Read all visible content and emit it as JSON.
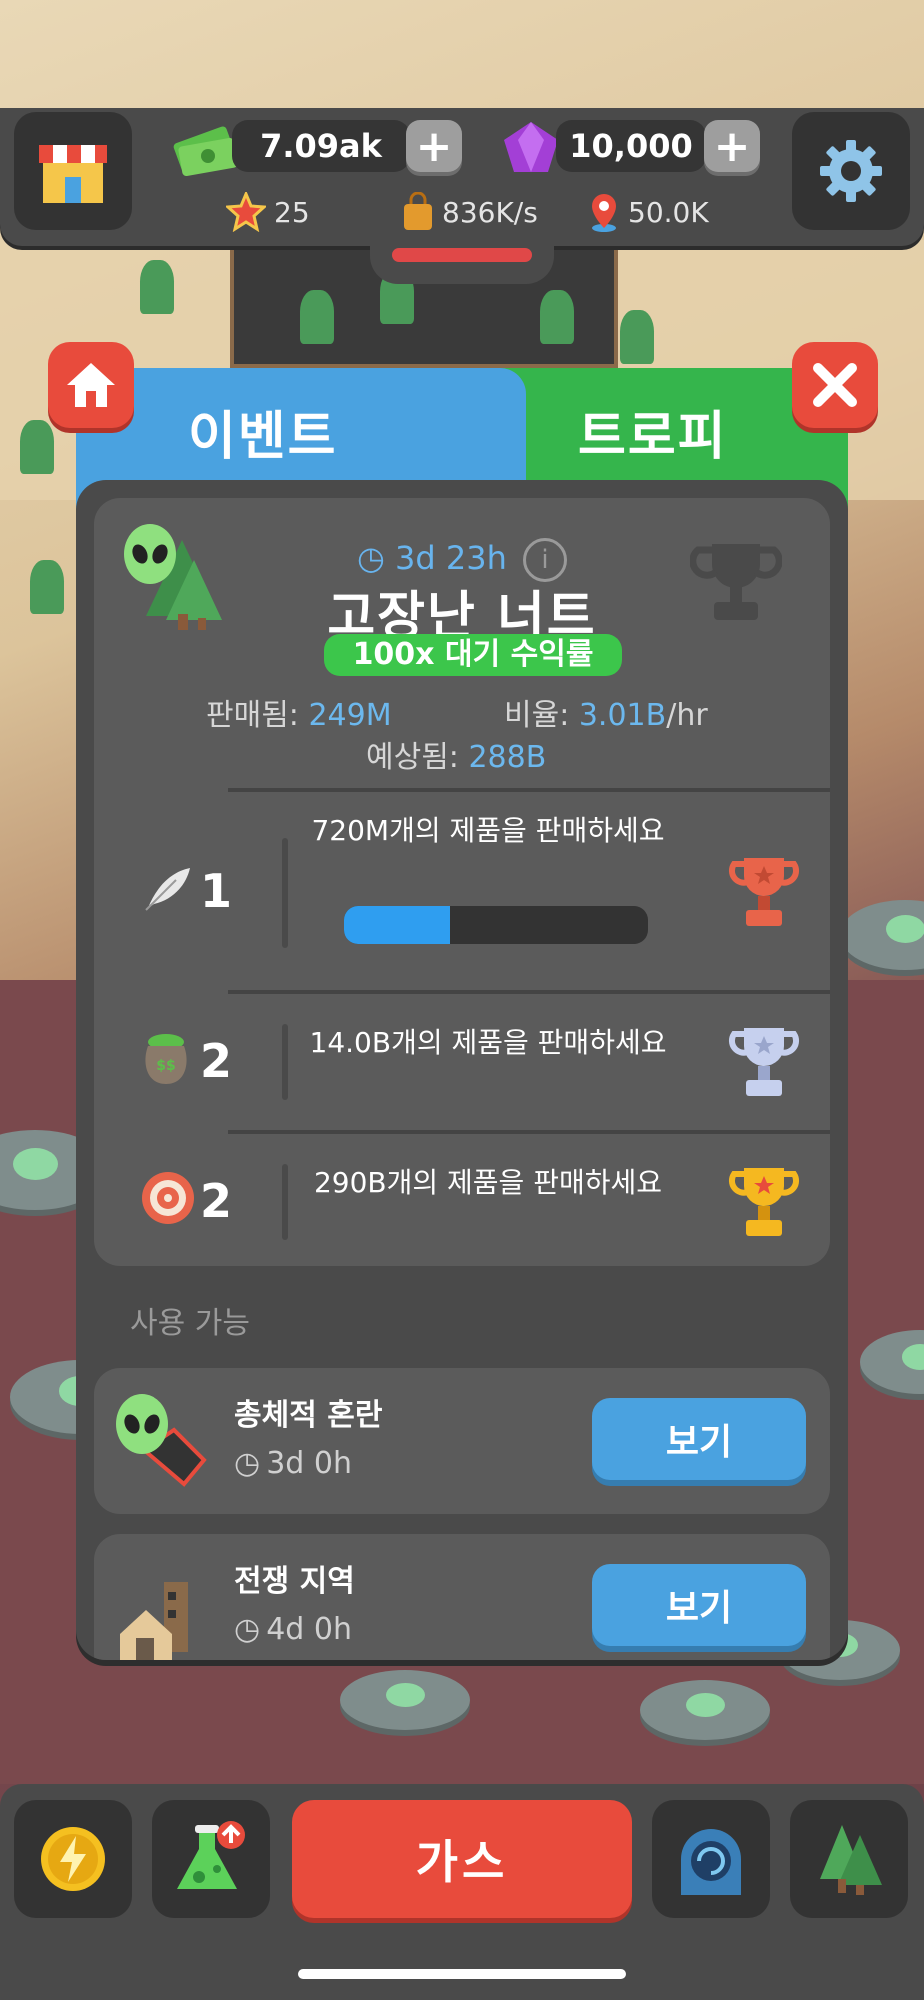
{
  "topbar": {
    "cash": "7.09ak",
    "gems": "10,000",
    "stars": "25",
    "income_rate": "836K/s",
    "location_value": "50.0K",
    "shop_icon": "shop-icon",
    "settings_icon": "gear-icon"
  },
  "tabs": {
    "event": "이벤트",
    "trophy": "트로피"
  },
  "event": {
    "timer": "3d 23h",
    "title": "고장난 너트",
    "badge": "100x 대기 수익률",
    "sold_label": "판매됨: ",
    "sold_value": "249M",
    "rate_label": "비율: ",
    "rate_value": "3.01B",
    "rate_unit": "/hr",
    "expected_label": "예상됨: ",
    "expected_value": "288B"
  },
  "goals": [
    {
      "count": "1",
      "text": "720M개의 제품을 판매하세요",
      "reward": "bronze-trophy-icon",
      "progress": 0.35,
      "icon": "feather-icon"
    },
    {
      "count": "2",
      "text": "14.0B개의 제품을 판매하세요",
      "reward": "silver-trophy-icon",
      "icon": "money-pot-icon"
    },
    {
      "count": "2",
      "text": "290B개의 제품을 판매하세요",
      "reward": "gold-trophy-icon",
      "icon": "target-icon"
    }
  ],
  "available": {
    "label": "사용 가능",
    "items": [
      {
        "name": "총체적 혼란",
        "duration": "3d 0h",
        "button": "보기"
      },
      {
        "name": "전쟁 지역",
        "duration": "4d 0h",
        "button": "보기"
      }
    ]
  },
  "bottom": {
    "gas_label": "가스"
  },
  "colors": {
    "accent_blue": "#4aa2e0",
    "accent_green": "#35b54c",
    "accent_red": "#e84b3c",
    "panel": "#4a4a4a",
    "progress": "#2f9ef0"
  }
}
